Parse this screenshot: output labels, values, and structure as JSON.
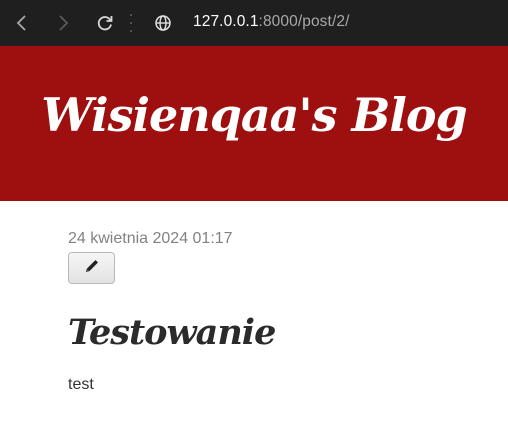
{
  "browser": {
    "url_host": "127.0.0.1",
    "url_rest": ":8000/post/2/",
    "icons": {
      "back": "back-arrow-icon",
      "forward": "forward-arrow-icon",
      "reload": "reload-icon",
      "site_info": "globe-icon"
    }
  },
  "header": {
    "site_title": "Wisienqaa's Blog",
    "background_color": "#9e0f0f"
  },
  "post": {
    "date": "24 kwietnia 2024 01:17",
    "edit_icon": "pencil-icon",
    "title": "Testowanie",
    "body": "test"
  }
}
